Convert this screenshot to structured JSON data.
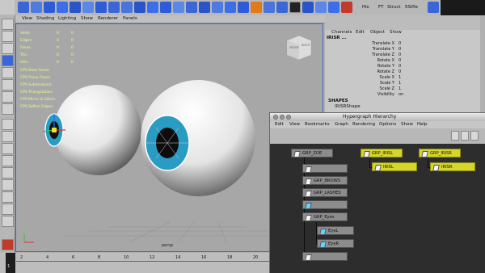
{
  "shelf": {
    "labels": [
      "His",
      "FT",
      "Struct",
      "5Stfle",
      "SStruct"
    ],
    "colors": {
      "blue": "#2e5bd8",
      "orange": "#e07a1a",
      "red": "#c23a2a"
    }
  },
  "viewport": {
    "menu": [
      "View",
      "Shading",
      "Lighting",
      "Show",
      "Renderer",
      "Panels"
    ],
    "hud_stats": [
      {
        "label": "Verts:",
        "v1": "0",
        "v2": "0"
      },
      {
        "label": "Edges:",
        "v1": "0",
        "v2": "0"
      },
      {
        "label": "Faces:",
        "v1": "0",
        "v2": "0"
      },
      {
        "label": "Tris:",
        "v1": "0",
        "v2": "0"
      },
      {
        "label": "UVs:",
        "v1": "0",
        "v2": "0"
      }
    ],
    "hud_cps": [
      "CPS Base Faces:",
      "CPS Proxy Faces:",
      "CPS Subdivisions:",
      "CPS Triangulation:",
      "CPS Mirror & Stitch:",
      "CPS Soften Edges:"
    ],
    "camera_label": "persp",
    "viewcube_label": "FRONT",
    "viewcube_right": "RIGHT"
  },
  "channel_box": {
    "tabs": [
      "Channels",
      "Edit",
      "Object",
      "Show"
    ],
    "object_name": "IRISR",
    "channels": [
      {
        "name": "Translate X",
        "value": "0"
      },
      {
        "name": "Translate Y",
        "value": "0"
      },
      {
        "name": "Translate Z",
        "value": "0"
      },
      {
        "name": "Rotate X",
        "value": "0"
      },
      {
        "name": "Rotate Y",
        "value": "0"
      },
      {
        "name": "Rotate Z",
        "value": "0"
      },
      {
        "name": "Scale X",
        "value": "1"
      },
      {
        "name": "Scale Y",
        "value": "1"
      },
      {
        "name": "Scale Z",
        "value": "1"
      },
      {
        "name": "Visibility",
        "value": "on"
      }
    ],
    "shapes_header": "SHAPES",
    "shape_name": "IRISRShape"
  },
  "timeline": {
    "ticks": [
      "2",
      "4",
      "6",
      "8",
      "10",
      "12",
      "14",
      "16",
      "18",
      "20"
    ],
    "current_frame": "1"
  },
  "hypergraph": {
    "title": "Hypergraph Hierarchy",
    "menu": [
      "Edit",
      "View",
      "Bookmarks",
      "Graph",
      "Rendering",
      "Options",
      "Show",
      "Help"
    ],
    "nodes": {
      "grp_zoe": "GRP_ZOE",
      "grp_brows": "GRP_BROWS",
      "grp_lashes": "GRP_LASHES",
      "grp_eyes": "GRP_Eyes",
      "eye_l": "EyeL",
      "eye_r": "EyeR",
      "grp_irisl": "GRP_IRISL",
      "irisl": "IRISL",
      "grp_irisr": "GRP_IRISR",
      "irisr": "IRISR"
    },
    "colors": {
      "selected": "#d5d52a",
      "node": "#8c8c8c",
      "background": "#2d2d2d"
    }
  }
}
